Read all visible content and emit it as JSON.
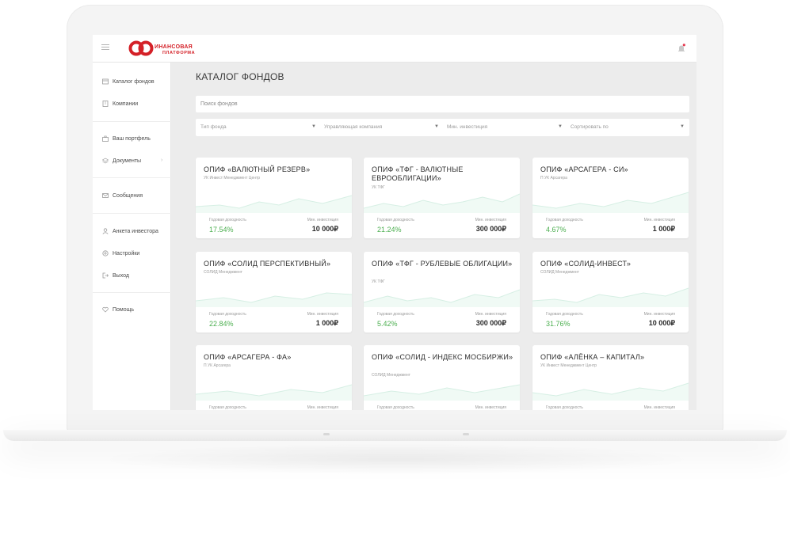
{
  "brand": {
    "logo_line1": "ИНАНСОВАЯ",
    "logo_line2": "ПЛАТФОРМА",
    "accent": "#d42027"
  },
  "sidebar": {
    "items": [
      {
        "label": "Каталог фондов",
        "icon": "catalog-icon"
      },
      {
        "label": "Компании",
        "icon": "building-icon"
      },
      {
        "label": "Ваш портфель",
        "icon": "briefcase-icon"
      },
      {
        "label": "Документы",
        "icon": "layers-icon"
      },
      {
        "label": "Сообщения",
        "icon": "envelope-icon"
      },
      {
        "label": "Анкета инвестора",
        "icon": "user-icon"
      },
      {
        "label": "Настройки",
        "icon": "gear-icon"
      },
      {
        "label": "Выход",
        "icon": "logout-icon"
      },
      {
        "label": "Помощь",
        "icon": "heart-icon"
      }
    ]
  },
  "main": {
    "title": "КАТАЛОГ ФОНДОВ",
    "search_placeholder": "Поиск фондов",
    "filters": [
      "Тип фонда",
      "Управляющая компания",
      "Мин. инвестиция",
      "Сортировать по"
    ]
  },
  "cards": [
    {
      "title": "ОПИФ «ВАЛЮТНЫЙ РЕЗЕРВ»",
      "company": "УК Инвест Менеджмент Центр",
      "yield_label": "Годовая доходность",
      "yield": "17.54%",
      "min_label": "Мин. инвестиция",
      "min": "10 000₽"
    },
    {
      "title": "ОПИФ «ТФГ - ВАЛЮТНЫЕ ЕВРООБЛИГАЦИИ»",
      "company": "УК ТФГ",
      "yield_label": "Годовая доходность",
      "yield": "21.24%",
      "min_label": "Мин. инвестиция",
      "min": "300 000₽"
    },
    {
      "title": "ОПИФ «АРСАГЕРА - СИ»",
      "company": "П УК Арсагера",
      "yield_label": "Годовая доходность",
      "yield": "4.67%",
      "min_label": "Мин. инвестиция",
      "min": "1 000₽"
    },
    {
      "title": "ОПИФ «СОЛИД ПЕРСПЕКТИВНЫЙ»",
      "company": "СОЛИД Менеджмент",
      "yield_label": "Годовая доходность",
      "yield": "22.84%",
      "min_label": "Мин. инвестиция",
      "min": "1 000₽"
    },
    {
      "title": "ОПИФ «ТФГ - РУБЛЕВЫЕ ОБЛИГАЦИИ»",
      "company": "УК ТФГ",
      "yield_label": "Годовая доходность",
      "yield": "5.42%",
      "min_label": "Мин. инвестиция",
      "min": "300 000₽"
    },
    {
      "title": "ОПИФ «СОЛИД-ИНВЕСТ»",
      "company": "СОЛИД Менеджмент",
      "yield_label": "Годовая доходность",
      "yield": "31.76%",
      "min_label": "Мин. инвестиция",
      "min": "10 000₽"
    },
    {
      "title": "ОПИФ «АРСАГЕРА - ФА»",
      "company": "П УК Арсагера",
      "yield_label": "Годовая доходность",
      "yield": "",
      "min_label": "Мин. инвестиция",
      "min": ""
    },
    {
      "title": "ОПИФ «СОЛИД - ИНДЕКС МОСБИРЖИ»",
      "company": "СОЛИД Менеджмент",
      "yield_label": "Годовая доходность",
      "yield": "",
      "min_label": "Мин. инвестиция",
      "min": ""
    },
    {
      "title": "ОПИФ «АЛЁНКА – КАПИТАЛ»",
      "company": "УК Инвест Менеджмент Центр",
      "yield_label": "Годовая доходность",
      "yield": "",
      "min_label": "Мин. инвестиция",
      "min": ""
    }
  ],
  "colors": {
    "yield_green": "#4caf50",
    "chart_fill": "#e8f7f0",
    "chart_line": "#d6efe4",
    "notification_dot": "#e53950"
  }
}
